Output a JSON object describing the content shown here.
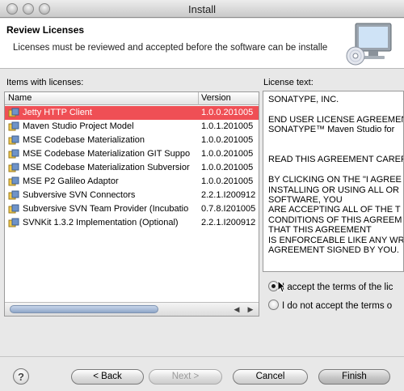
{
  "window": {
    "title": "Install"
  },
  "header": {
    "title": "Review Licenses",
    "description": "Licenses must be reviewed and accepted before the software can be installe"
  },
  "items_panel": {
    "label": "Items with licenses:",
    "columns": {
      "name": "Name",
      "version": "Version"
    },
    "rows": [
      {
        "name": "Jetty HTTP Client",
        "version": "1.0.0.201005",
        "selected": true
      },
      {
        "name": "Maven Studio Project Model",
        "version": "1.0.1.201005"
      },
      {
        "name": "MSE Codebase Materialization",
        "version": "1.0.0.201005"
      },
      {
        "name": "MSE Codebase Materialization GIT Suppo",
        "version": "1.0.0.201005"
      },
      {
        "name": "MSE Codebase Materialization Subversior",
        "version": "1.0.0.201005"
      },
      {
        "name": "MSE P2 Galileo Adaptor",
        "version": "1.0.0.201005"
      },
      {
        "name": "Subversive SVN Connectors",
        "version": "2.2.1.I200912"
      },
      {
        "name": "Subversive SVN Team Provider (Incubatio",
        "version": "0.7.8.I201005"
      },
      {
        "name": "SVNKit 1.3.2 Implementation (Optional)",
        "version": "2.2.1.I200912"
      }
    ]
  },
  "license_panel": {
    "label": "License text:",
    "text": "SONATYPE, INC.\n\nEND USER LICENSE AGREEMENT\nSONATYPE™ Maven Studio for\n\n\nREAD THIS AGREEMENT CAREF\n\nBY CLICKING ON THE \"I AGREE\nINSTALLING OR USING ALL OR\nSOFTWARE, YOU\nARE ACCEPTING ALL OF THE T\nCONDITIONS OF THIS AGREEM\nTHAT THIS AGREEMENT\nIS ENFORCEABLE LIKE ANY WRI\nAGREEMENT SIGNED BY YOU."
  },
  "choices": {
    "accept": "I accept the terms of the lic",
    "reject": "I do not accept the terms o"
  },
  "buttons": {
    "back": "< Back",
    "next": "Next >",
    "cancel": "Cancel",
    "finish": "Finish",
    "help": "?"
  }
}
